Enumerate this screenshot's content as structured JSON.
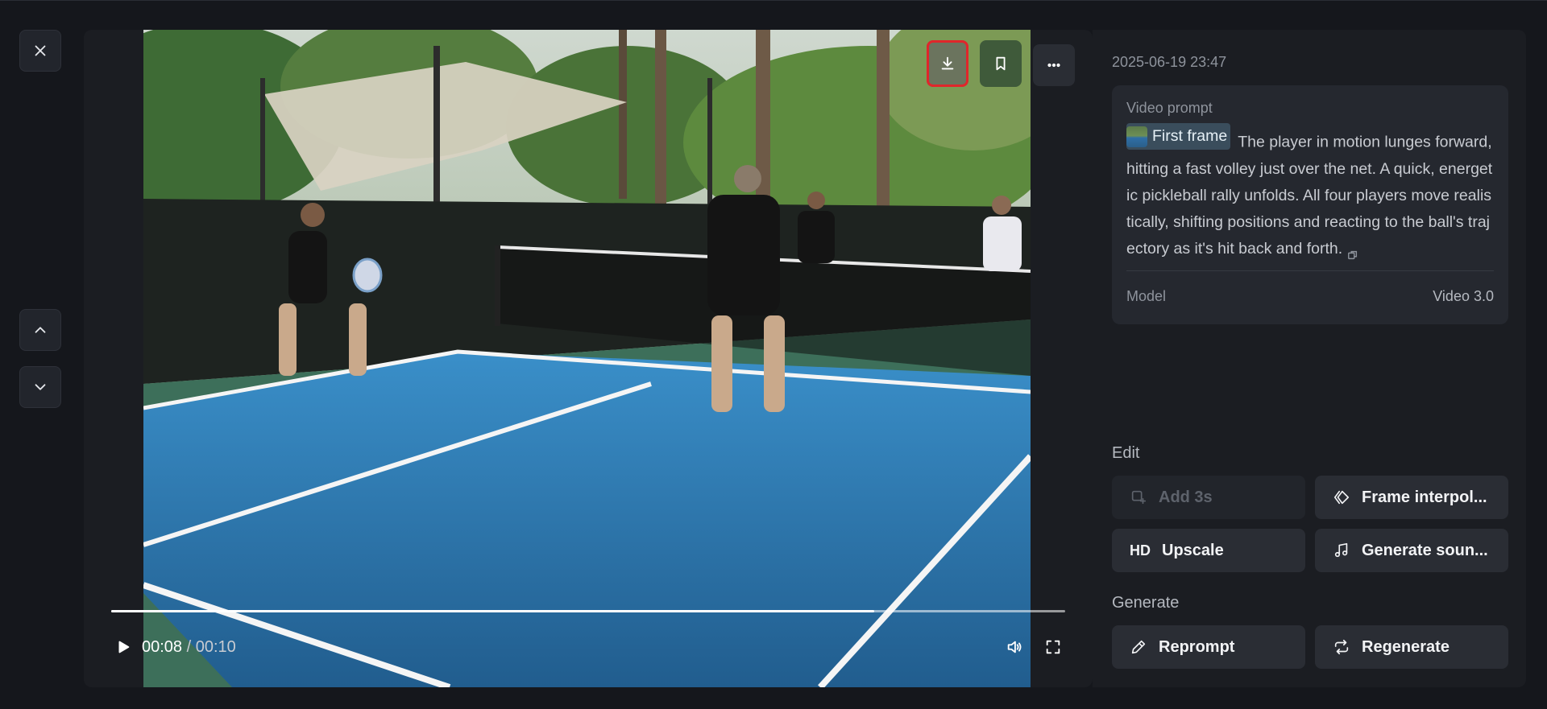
{
  "nav": {
    "close_icon": "close-icon",
    "prev_icon": "chevron-up-icon",
    "next_icon": "chevron-down-icon"
  },
  "overlay": {
    "download_icon": "download-icon",
    "bookmark_icon": "bookmark-icon",
    "more_icon": "more-horizontal-icon",
    "accent_download": "#6b745e",
    "accent_bookmark": "#3f5a3a",
    "highlight_border": "#e0262b"
  },
  "player": {
    "current_time": "00:08",
    "separator": " / ",
    "duration": "00:10",
    "progress": 0.8,
    "play_icon": "play-icon",
    "volume_icon": "volume-icon",
    "fullscreen_icon": "fullscreen-icon"
  },
  "panel": {
    "timestamp": "2025-06-19 23:47",
    "prompt_label": "Video prompt",
    "chip_label": "First frame",
    "prompt_text": " The player in motion lunges forward, hitting a fast volley just over the net. A quick, energetic pickleball rally unfolds. All four players move realistically, shifting positions and reacting to the ball's trajectory as it's hit back and forth.",
    "copy_icon": "copy-icon",
    "model_label": "Model",
    "model_value": "Video 3.0"
  },
  "edit": {
    "label": "Edit",
    "add_label": "Add 3s",
    "interp_label": "Frame interpol...",
    "upscale_label": "Upscale",
    "upscale_glyph": "HD",
    "sound_label": "Generate soun..."
  },
  "generate": {
    "label": "Generate",
    "reprompt_label": "Reprompt",
    "regenerate_label": "Regenerate"
  }
}
